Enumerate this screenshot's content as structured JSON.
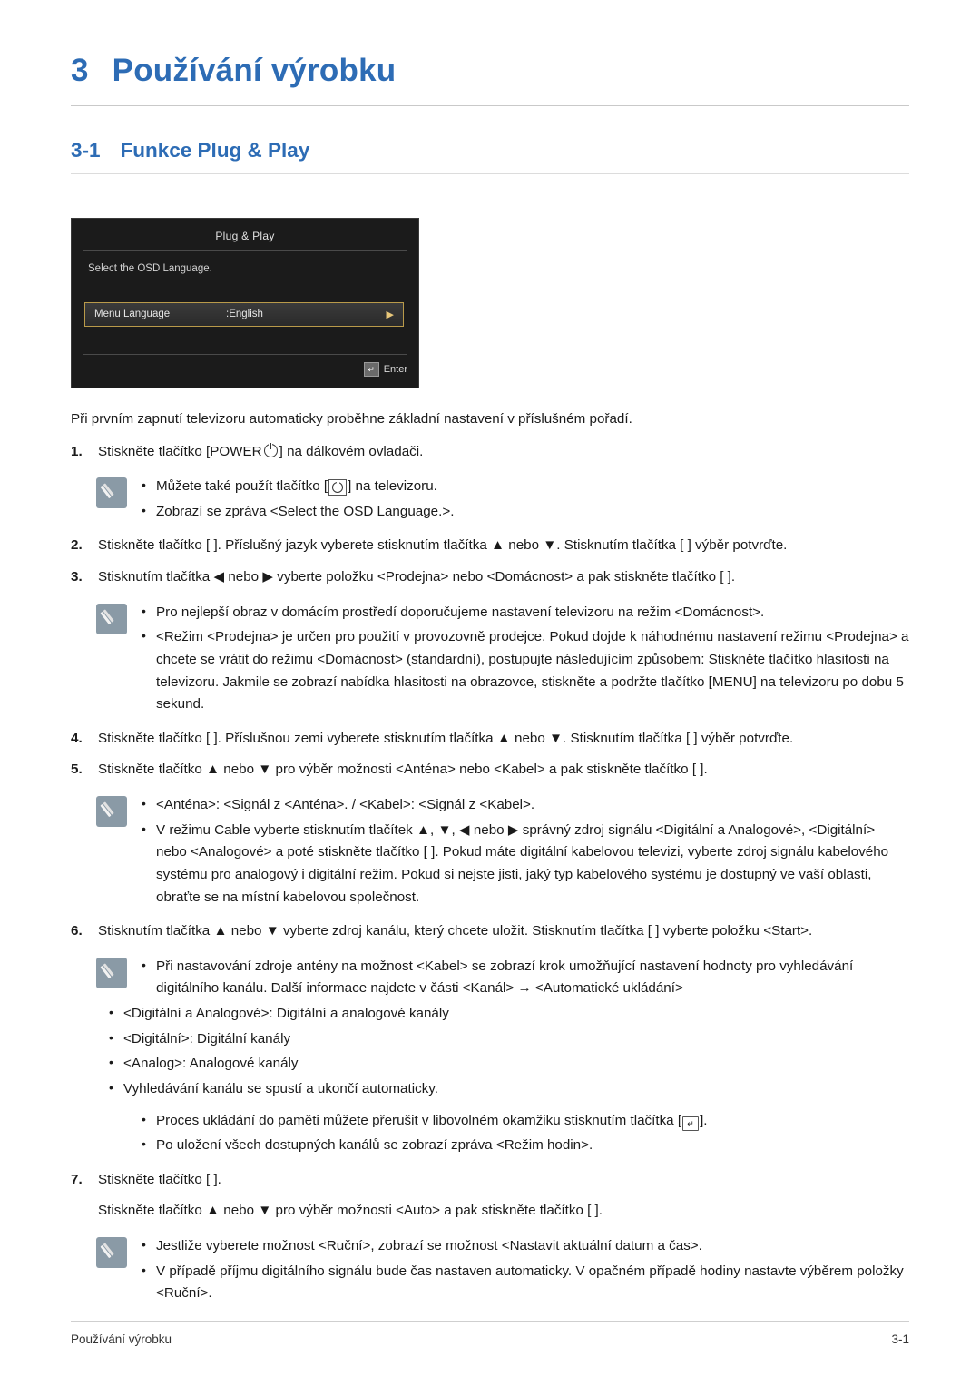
{
  "chapter": {
    "number": "3",
    "title": "Používání výrobku"
  },
  "section": {
    "number": "3-1",
    "title": "Funkce Plug & Play"
  },
  "osd": {
    "title": "Plug & Play",
    "description": "Select the OSD Language.",
    "row_label": "Menu Language",
    "row_value": ":English",
    "row_arrow": "▶",
    "enter_label": "Enter",
    "enter_key_glyph": "↵"
  },
  "intro": "Při prvním zapnutí televizoru automaticky proběhne základní nastavení v příslušném pořadí.",
  "steps": [
    {
      "index": "1.",
      "text_before": "Stiskněte tlačítko [POWER",
      "text_after": "] na dálkovém ovladači.",
      "note": [
        {
          "before": "Můžete také použít tlačítko [",
          "after": "] na televizoru."
        },
        {
          "before": "Zobrazí se zpráva <Select the OSD Language.>.",
          "after": ""
        }
      ]
    },
    {
      "index": "2.",
      "text": "Stiskněte tlačítko [ ]. Příslušný jazyk vyberete stisknutím tlačítka ▲ nebo ▼. Stisknutím tlačítka [ ] výběr potvrďte."
    },
    {
      "index": "3.",
      "text": "Stisknutím tlačítka ◀ nebo ▶ vyberte položku <Prodejna> nebo <Domácnost> a pak stiskněte tlačítko [ ]."
    },
    {
      "index": "4.",
      "text": "Stiskněte tlačítko [ ]. Příslušnou zemi vyberete stisknutím tlačítka ▲ nebo ▼. Stisknutím tlačítka [ ] výběr potvrďte."
    },
    {
      "index": "5.",
      "text": "Stiskněte tlačítko ▲ nebo ▼ pro výběr možnosti <Anténa> nebo <Kabel> a pak stiskněte tlačítko [ ]."
    },
    {
      "index": "6.",
      "text": "Stisknutím tlačítka ▲ nebo ▼ vyberte zdroj kanálu, který chcete uložit. Stisknutím tlačítka [ ] vyberte položku <Start>."
    },
    {
      "index": "7.",
      "text": "Stiskněte tlačítko [ ].",
      "substep": "Stiskněte tlačítko ▲ nebo ▼ pro výběr možnosti <Auto> a pak stiskněte tlačítko [ ]."
    }
  ],
  "note3": [
    "Pro nejlepší obraz v domácím prostředí doporučujeme nastavení televizoru na režim <Domácnost>.",
    "<Režim <Prodejna> je určen pro použití v provozovně prodejce. Pokud dojde k náhodnému nastavení režimu <Prodejna> a chcete se vrátit do režimu <Domácnost> (standardní), postupujte následujícím způsobem: Stiskněte tlačítko hlasitosti na televizoru. Jakmile se zobrazí nabídka hlasitosti na obrazovce, stiskněte a podržte tlačítko [MENU] na televizoru po dobu 5 sekund."
  ],
  "note5": [
    "<Anténa>: <Signál z <Anténa>. / <Kabel>: <Signál z <Kabel>.",
    "V režimu Cable vyberte stisknutím tlačítek ▲, ▼, ◀ nebo ▶ správný zdroj signálu <Digitální a Analogové>, <Digitální> nebo <Analogové> a poté stiskněte tlačítko [ ]. Pokud máte digitální kabelovou televizi, vyberte zdroj signálu kabelového systému pro analogový i digitální režim. Pokud si nejste jisti, jaký typ kabelového systému je dostupný ve vaší oblasti, obraťte se na místní kabelovou společnost."
  ],
  "note6": [
    "Při nastavování zdroje antény na možnost <Kabel> se zobrazí krok umožňující nastavení hodnoty pro vyhledávání digitálního kanálu. Další informace najdete v části <Kanál> → <Automatické ukládání>"
  ],
  "note6_plain": [
    "<Digitální a Analogové>: Digitální a analogové kanály",
    "<Digitální>: Digitální kanály",
    "<Analog>: Analogové kanály",
    "Vyhledávání kanálu se spustí a ukončí automaticky."
  ],
  "note6_extra": [
    {
      "before": "Proces ukládání do paměti můžete přerušit v libovolném okamžiku stisknutím tlačítka [",
      "after": "]."
    },
    {
      "before": "Po uložení všech dostupných kanálů se zobrazí zpráva <Režim hodin>.",
      "after": ""
    }
  ],
  "note7": [
    "Jestliže vyberete možnost <Ruční>, zobrazí se možnost <Nastavit aktuální datum a čas>.",
    "V případě příjmu digitálního signálu bude čas nastaven automaticky. V opačném případě hodiny nastavte výběrem položky <Ruční>."
  ],
  "footer": {
    "left": "Používání výrobku",
    "right": "3-1"
  },
  "colors": {
    "heading": "#2d6cb5",
    "text": "#1a1a1a",
    "rule": "#c9c9c9"
  }
}
